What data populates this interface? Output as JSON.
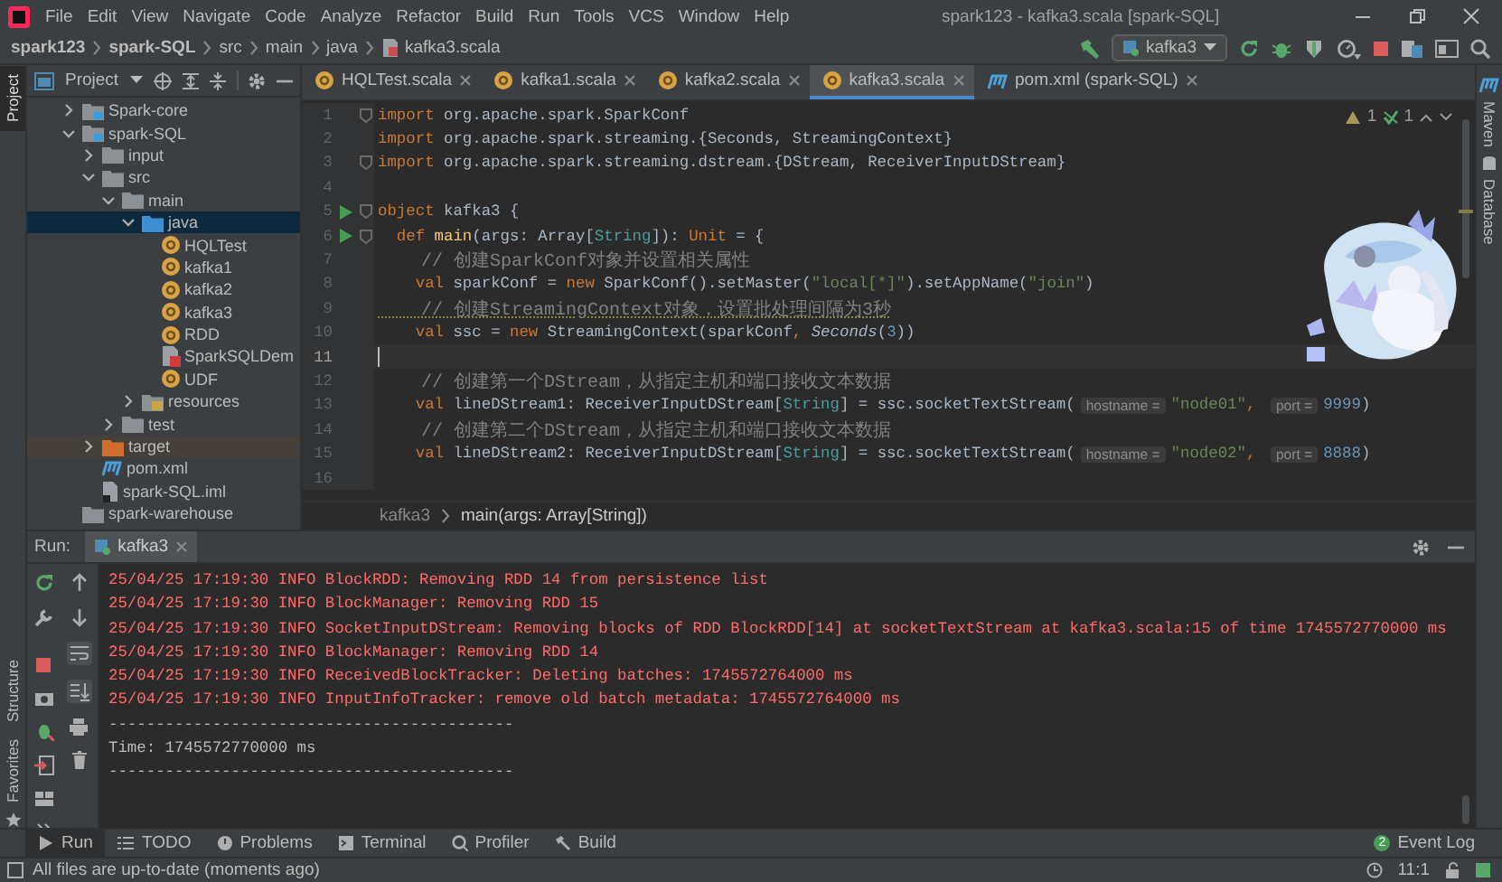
{
  "menu_bar": {
    "items": [
      "File",
      "Edit",
      "View",
      "Navigate",
      "Code",
      "Analyze",
      "Refactor",
      "Build",
      "Run",
      "Tools",
      "VCS",
      "Window",
      "Help"
    ],
    "window_title": "spark123 - kafka3.scala [spark-SQL]"
  },
  "navigation_bar": {
    "breadcrumbs": [
      "spark123",
      "spark-SQL",
      "src",
      "main",
      "java",
      "kafka3.scala"
    ],
    "run_configuration": "kafka3"
  },
  "left_tool_strip": [
    {
      "label": "Project",
      "selected": true
    },
    {
      "label": "Structure",
      "selected": false
    },
    {
      "label": "Favorites",
      "selected": false
    }
  ],
  "right_tool_strip": [
    "Maven",
    "Database"
  ],
  "project_panel": {
    "title": "Project",
    "tree": [
      {
        "label": "Spark-core",
        "kind": "module",
        "expanded": false,
        "selected": false
      },
      {
        "label": "spark-SQL",
        "kind": "module",
        "expanded": true,
        "selected": false,
        "children": [
          {
            "label": "input",
            "kind": "folder",
            "expanded": false,
            "selected": false
          },
          {
            "label": "src",
            "kind": "folder",
            "expanded": true,
            "selected": false,
            "children": [
              {
                "label": "main",
                "kind": "folder",
                "expanded": true,
                "selected": false,
                "children": [
                  {
                    "label": "java",
                    "kind": "source-folder",
                    "expanded": true,
                    "selected": true,
                    "children": [
                      {
                        "label": "HQLTest",
                        "kind": "object",
                        "selected": false
                      },
                      {
                        "label": "kafka1",
                        "kind": "object",
                        "selected": false
                      },
                      {
                        "label": "kafka2",
                        "kind": "object",
                        "selected": false
                      },
                      {
                        "label": "kafka3",
                        "kind": "object",
                        "selected": false
                      },
                      {
                        "label": "RDD",
                        "kind": "object",
                        "selected": false
                      },
                      {
                        "label": "SparkSQLDem",
                        "kind": "script",
                        "selected": false
                      },
                      {
                        "label": "UDF",
                        "kind": "object",
                        "selected": false
                      }
                    ]
                  },
                  {
                    "label": "resources",
                    "kind": "resources-folder",
                    "expanded": false,
                    "selected": false
                  }
                ]
              },
              {
                "label": "test",
                "kind": "folder",
                "expanded": false,
                "selected": false
              }
            ]
          },
          {
            "label": "target",
            "kind": "excluded-folder",
            "expanded": false,
            "selected": false
          },
          {
            "label": "pom.xml",
            "kind": "maven-file",
            "selected": false
          },
          {
            "label": "spark-SQL.iml",
            "kind": "module-file",
            "selected": false
          }
        ]
      },
      {
        "label": "spark-warehouse",
        "kind": "folder",
        "selected": false
      }
    ]
  },
  "editor": {
    "tabs": [
      {
        "label": "HQLTest.scala",
        "kind": "scala",
        "selected": false
      },
      {
        "label": "kafka1.scala",
        "kind": "scala",
        "selected": false
      },
      {
        "label": "kafka2.scala",
        "kind": "scala",
        "selected": false
      },
      {
        "label": "kafka3.scala",
        "kind": "scala",
        "selected": true
      },
      {
        "label": "pom.xml (spark-SQL)",
        "kind": "maven",
        "selected": false
      }
    ],
    "inspections": {
      "warnings": "1",
      "weak_warnings": "1"
    },
    "lines": [
      {
        "number": "1",
        "current": false,
        "run_marker": false,
        "fold_marker": true,
        "tokens": [
          {
            "kind": "keyword",
            "text": "import"
          },
          {
            "kind": "plain",
            "text": " org.apache.spark.SparkConf"
          }
        ]
      },
      {
        "number": "2",
        "current": false,
        "run_marker": false,
        "fold_marker": false,
        "tokens": [
          {
            "kind": "keyword",
            "text": "import"
          },
          {
            "kind": "plain",
            "text": " org.apache.spark.streaming.{Seconds, StreamingContext}"
          }
        ]
      },
      {
        "number": "3",
        "current": false,
        "run_marker": false,
        "fold_marker": true,
        "tokens": [
          {
            "kind": "keyword",
            "text": "import"
          },
          {
            "kind": "plain",
            "text": " org.apache.spark.streaming.dstream.{DStream, ReceiverInputDStream}"
          }
        ]
      },
      {
        "number": "4",
        "current": false,
        "run_marker": false,
        "fold_marker": false
      },
      {
        "number": "5",
        "current": false,
        "run_marker": true,
        "fold_marker": true,
        "tokens": [
          {
            "kind": "keyword",
            "text": "object"
          },
          {
            "kind": "plain",
            "text": " kafka3 {"
          }
        ]
      },
      {
        "number": "6",
        "current": false,
        "run_marker": true,
        "fold_marker": true,
        "tokens": [
          {
            "kind": "keyword",
            "text": "  def "
          },
          {
            "kind": "function-name",
            "text": "main"
          },
          {
            "kind": "plain",
            "text": "(args: Array["
          },
          {
            "kind": "type-param",
            "text": "String"
          },
          {
            "kind": "plain",
            "text": "]): "
          },
          {
            "kind": "keyword",
            "text": "Unit"
          },
          {
            "kind": "plain",
            "text": " = {"
          }
        ]
      },
      {
        "number": "7",
        "current": false,
        "run_marker": false,
        "fold_marker": false,
        "tokens": [
          {
            "kind": "comment",
            "text": "    // 创建SparkConf对象并设置相关属性"
          }
        ]
      },
      {
        "number": "8",
        "current": false,
        "run_marker": false,
        "fold_marker": false,
        "tokens": [
          {
            "kind": "keyword",
            "text": "    val"
          },
          {
            "kind": "plain",
            "text": " sparkConf = "
          },
          {
            "kind": "keyword",
            "text": "new"
          },
          {
            "kind": "plain",
            "text": " SparkConf().setMaster("
          },
          {
            "kind": "string",
            "text": "\"local[*]\""
          },
          {
            "kind": "plain",
            "text": ").setAppName("
          },
          {
            "kind": "string",
            "text": "\"join\""
          },
          {
            "kind": "plain",
            "text": ")"
          }
        ]
      },
      {
        "number": "9",
        "current": false,
        "run_marker": false,
        "fold_marker": false,
        "tokens": [
          {
            "kind": "comment-flagged",
            "text": "    // 创建StreamingContext对象，设置批处理间隔为3秒"
          }
        ]
      },
      {
        "number": "10",
        "current": false,
        "run_marker": false,
        "fold_marker": false,
        "tokens": [
          {
            "kind": "keyword",
            "text": "    val"
          },
          {
            "kind": "plain",
            "text": " ssc = "
          },
          {
            "kind": "keyword",
            "text": "new"
          },
          {
            "kind": "plain",
            "text": " StreamingContext(sparkConf"
          },
          {
            "kind": "keyword",
            "text": ", "
          },
          {
            "kind": "italic",
            "text": "Seconds"
          },
          {
            "kind": "plain",
            "text": "("
          },
          {
            "kind": "number",
            "text": "3"
          },
          {
            "kind": "plain",
            "text": "))"
          }
        ]
      },
      {
        "number": "11",
        "current": true,
        "run_marker": false,
        "fold_marker": false
      },
      {
        "number": "12",
        "current": false,
        "run_marker": false,
        "fold_marker": false,
        "tokens": [
          {
            "kind": "comment",
            "text": "    // 创建第一个DStream，从指定主机和端口接收文本数据"
          }
        ]
      },
      {
        "number": "13",
        "current": false,
        "run_marker": false,
        "fold_marker": false,
        "tokens": [
          {
            "kind": "keyword",
            "text": "    val"
          },
          {
            "kind": "plain",
            "text": " lineDStream1: ReceiverInputDStream["
          },
          {
            "kind": "type-param",
            "text": "String"
          },
          {
            "kind": "plain",
            "text": "] = ssc.socketTextStream("
          },
          {
            "kind": "hint",
            "text": "hostname ="
          },
          {
            "kind": "string",
            "text": "\"node01\""
          },
          {
            "kind": "keyword",
            "text": ", "
          },
          {
            "kind": "hint",
            "text": "port ="
          },
          {
            "kind": "number",
            "text": "9999"
          },
          {
            "kind": "plain",
            "text": ")"
          }
        ]
      },
      {
        "number": "14",
        "current": false,
        "run_marker": false,
        "fold_marker": false,
        "tokens": [
          {
            "kind": "comment",
            "text": "    // 创建第二个DStream，从指定主机和端口接收文本数据"
          }
        ]
      },
      {
        "number": "15",
        "current": false,
        "run_marker": false,
        "fold_marker": false,
        "tokens": [
          {
            "kind": "keyword",
            "text": "    val"
          },
          {
            "kind": "plain",
            "text": " lineDStream2: ReceiverInputDStream["
          },
          {
            "kind": "type-param",
            "text": "String"
          },
          {
            "kind": "plain",
            "text": "] = ssc.socketTextStream("
          },
          {
            "kind": "hint",
            "text": "hostname ="
          },
          {
            "kind": "string",
            "text": "\"node02\""
          },
          {
            "kind": "keyword",
            "text": ", "
          },
          {
            "kind": "hint",
            "text": "port ="
          },
          {
            "kind": "number",
            "text": "8888"
          },
          {
            "kind": "plain",
            "text": ")"
          }
        ]
      },
      {
        "number": "16",
        "current": false,
        "run_marker": false,
        "fold_marker": false
      }
    ],
    "breadcrumbs": [
      "kafka3",
      "main(args: Array[String])"
    ]
  },
  "run_panel": {
    "label": "Run:",
    "tab": "kafka3",
    "lines": [
      {
        "kind": "error",
        "text": "25/04/25 17:19:30 INFO BlockRDD: Removing RDD 14 from persistence list"
      },
      {
        "kind": "error",
        "text": "25/04/25 17:19:30 INFO BlockManager: Removing RDD 15"
      },
      {
        "kind": "error",
        "text": "25/04/25 17:19:30 INFO SocketInputDStream: Removing blocks of RDD BlockRDD[14] at socketTextStream at kafka3.scala:15 of time 1745572770000 ms"
      },
      {
        "kind": "error",
        "text": "25/04/25 17:19:30 INFO BlockManager: Removing RDD 14"
      },
      {
        "kind": "error",
        "text": "25/04/25 17:19:30 INFO ReceivedBlockTracker: Deleting batches: 1745572764000 ms"
      },
      {
        "kind": "error",
        "text": "25/04/25 17:19:30 INFO InputInfoTracker: remove old batch metadata: 1745572764000 ms"
      },
      {
        "kind": "output",
        "text": "-------------------------------------------"
      },
      {
        "kind": "output",
        "text": "Time: 1745572770000 ms"
      },
      {
        "kind": "output",
        "text": "-------------------------------------------"
      }
    ]
  },
  "tool_windows": [
    {
      "label": "Run",
      "kind": "run",
      "selected": true
    },
    {
      "label": "TODO",
      "kind": "todo",
      "selected": false
    },
    {
      "label": "Problems",
      "kind": "problems",
      "selected": false
    },
    {
      "label": "Terminal",
      "kind": "terminal",
      "selected": false
    },
    {
      "label": "Profiler",
      "kind": "profiler",
      "selected": false
    },
    {
      "label": "Build",
      "kind": "build",
      "selected": false
    }
  ],
  "event_log": {
    "label": "Event Log",
    "count": "2"
  },
  "status_bar": {
    "message": "All files are up-to-date (moments ago)",
    "position": "11:1"
  }
}
